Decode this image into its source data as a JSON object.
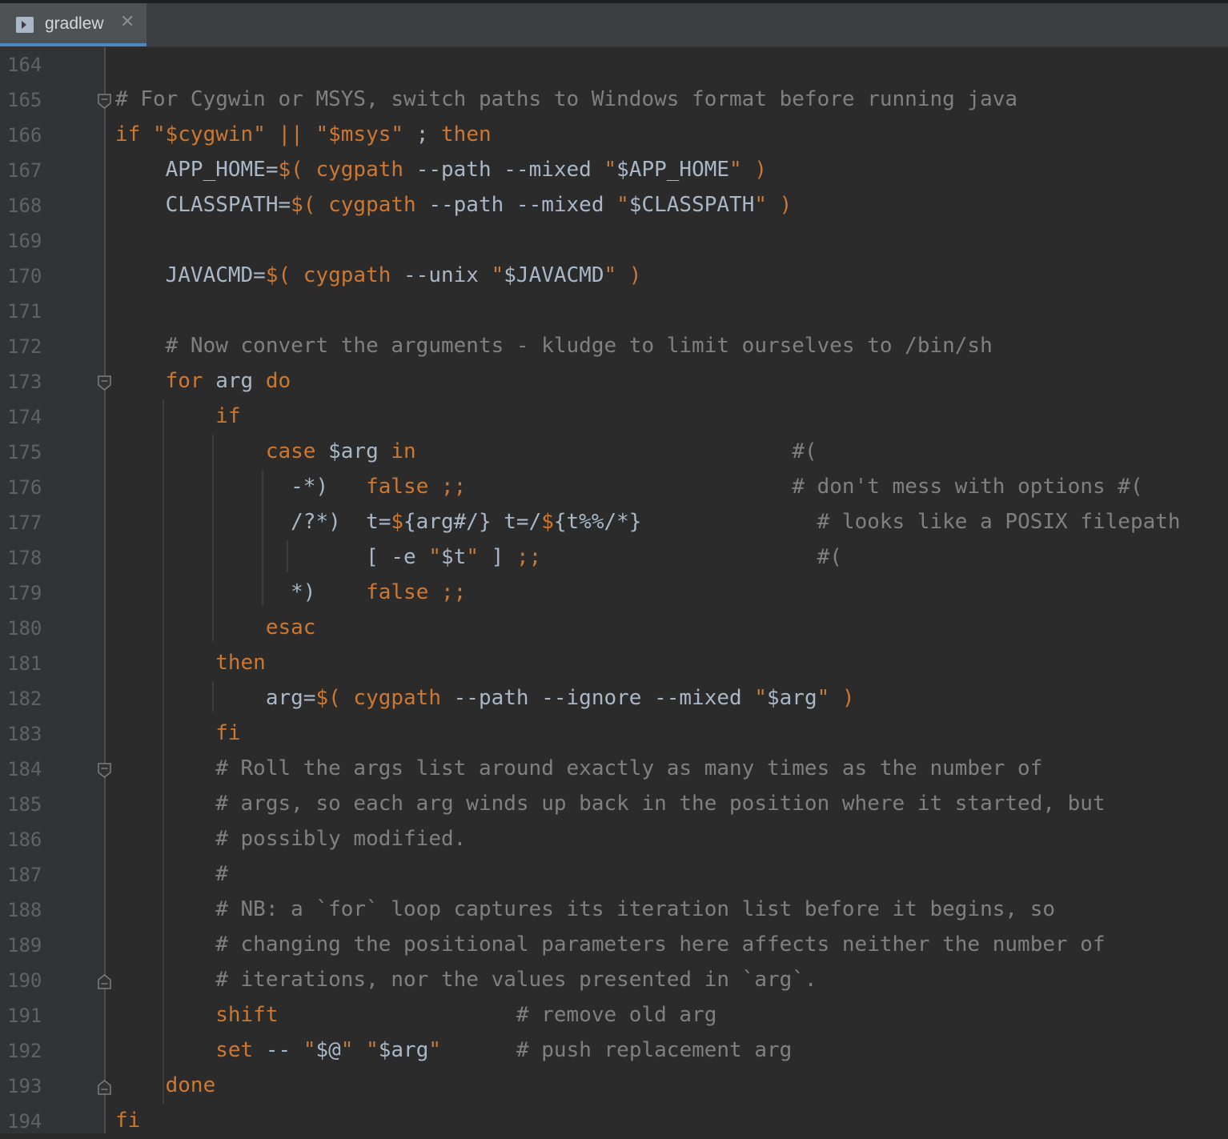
{
  "tab": {
    "title": "gradlew",
    "icon": "terminal-icon",
    "close_icon": "close-icon"
  },
  "colors": {
    "background": "#2b2b2b",
    "gutter": "#313335",
    "keyword": "#cc7832",
    "comment": "#808080",
    "text": "#a9b7c6",
    "line_number": "#606366",
    "tab_active_underline": "#4a88c7"
  },
  "lines": [
    {
      "num": "164",
      "fold": "",
      "parts": []
    },
    {
      "num": "165",
      "fold": "open-top",
      "parts": [
        {
          "t": "cm",
          "v": "# For Cygwin or MSYS, switch paths to Windows format before running java"
        }
      ]
    },
    {
      "num": "166",
      "fold": "",
      "parts": [
        {
          "t": "kw",
          "v": "if "
        },
        {
          "t": "kw",
          "v": "\"$cygwin\" || \"$msys\" "
        },
        {
          "t": "txt",
          "v": "; "
        },
        {
          "t": "kw",
          "v": "then"
        }
      ]
    },
    {
      "num": "167",
      "fold": "",
      "parts": [
        {
          "t": "txt",
          "v": "    APP_HOME="
        },
        {
          "t": "kw",
          "v": "$( cygpath "
        },
        {
          "t": "txt",
          "v": "--path --mixed "
        },
        {
          "t": "kw",
          "v": "\""
        },
        {
          "t": "txt",
          "v": "$APP_HOME"
        },
        {
          "t": "kw",
          "v": "\" )"
        }
      ]
    },
    {
      "num": "168",
      "fold": "",
      "parts": [
        {
          "t": "txt",
          "v": "    CLASSPATH="
        },
        {
          "t": "kw",
          "v": "$( cygpath "
        },
        {
          "t": "txt",
          "v": "--path --mixed "
        },
        {
          "t": "kw",
          "v": "\""
        },
        {
          "t": "txt",
          "v": "$CLASSPATH"
        },
        {
          "t": "kw",
          "v": "\" )"
        }
      ]
    },
    {
      "num": "169",
      "fold": "",
      "parts": []
    },
    {
      "num": "170",
      "fold": "",
      "parts": [
        {
          "t": "txt",
          "v": "    JAVACMD="
        },
        {
          "t": "kw",
          "v": "$( cygpath "
        },
        {
          "t": "txt",
          "v": "--unix "
        },
        {
          "t": "kw",
          "v": "\""
        },
        {
          "t": "txt",
          "v": "$JAVACMD"
        },
        {
          "t": "kw",
          "v": "\" )"
        }
      ]
    },
    {
      "num": "171",
      "fold": "",
      "parts": []
    },
    {
      "num": "172",
      "fold": "",
      "parts": [
        {
          "t": "cm",
          "v": "    # Now convert the arguments - kludge to limit ourselves to /bin/sh"
        }
      ]
    },
    {
      "num": "173",
      "fold": "open-top",
      "parts": [
        {
          "t": "kw",
          "v": "    for "
        },
        {
          "t": "txt",
          "v": "arg "
        },
        {
          "t": "kw",
          "v": "do"
        }
      ]
    },
    {
      "num": "174",
      "fold": "",
      "parts": [
        {
          "t": "kw",
          "v": "        if"
        }
      ]
    },
    {
      "num": "175",
      "fold": "",
      "parts": [
        {
          "t": "kw",
          "v": "            case "
        },
        {
          "t": "txt",
          "v": "$arg "
        },
        {
          "t": "kw",
          "v": "in"
        },
        {
          "t": "txt",
          "v": "                              "
        },
        {
          "t": "cm",
          "v": "#("
        }
      ]
    },
    {
      "num": "176",
      "fold": "",
      "parts": [
        {
          "t": "txt",
          "v": "              -*)   "
        },
        {
          "t": "kw",
          "v": "false ;;"
        },
        {
          "t": "txt",
          "v": "                          "
        },
        {
          "t": "cm",
          "v": "# don't mess with options #("
        }
      ]
    },
    {
      "num": "177",
      "fold": "",
      "parts": [
        {
          "t": "txt",
          "v": "              /?*)  t="
        },
        {
          "t": "kw",
          "v": "$"
        },
        {
          "t": "txt",
          "v": "{arg#/} t=/"
        },
        {
          "t": "kw",
          "v": "$"
        },
        {
          "t": "txt",
          "v": "{t%%/*}"
        },
        {
          "t": "txt",
          "v": "              "
        },
        {
          "t": "cm",
          "v": "# looks like a POSIX filepath"
        }
      ]
    },
    {
      "num": "178",
      "fold": "",
      "parts": [
        {
          "t": "txt",
          "v": "                    [ -e "
        },
        {
          "t": "kw",
          "v": "\""
        },
        {
          "t": "txt",
          "v": "$t"
        },
        {
          "t": "kw",
          "v": "\" "
        },
        {
          "t": "txt",
          "v": "] "
        },
        {
          "t": "kw",
          "v": ";;"
        },
        {
          "t": "txt",
          "v": "                      "
        },
        {
          "t": "cm",
          "v": "#("
        }
      ]
    },
    {
      "num": "179",
      "fold": "",
      "parts": [
        {
          "t": "txt",
          "v": "              *)    "
        },
        {
          "t": "kw",
          "v": "false ;;"
        }
      ]
    },
    {
      "num": "180",
      "fold": "",
      "parts": [
        {
          "t": "kw",
          "v": "            esac"
        }
      ]
    },
    {
      "num": "181",
      "fold": "",
      "parts": [
        {
          "t": "kw",
          "v": "        then"
        }
      ]
    },
    {
      "num": "182",
      "fold": "",
      "parts": [
        {
          "t": "txt",
          "v": "            arg="
        },
        {
          "t": "kw",
          "v": "$( cygpath "
        },
        {
          "t": "txt",
          "v": "--path --ignore --mixed "
        },
        {
          "t": "kw",
          "v": "\""
        },
        {
          "t": "txt",
          "v": "$arg"
        },
        {
          "t": "kw",
          "v": "\" )"
        }
      ]
    },
    {
      "num": "183",
      "fold": "",
      "parts": [
        {
          "t": "kw",
          "v": "        fi"
        }
      ]
    },
    {
      "num": "184",
      "fold": "open-top",
      "parts": [
        {
          "t": "cm",
          "v": "        # Roll the args list around exactly as many times as the number of"
        }
      ]
    },
    {
      "num": "185",
      "fold": "",
      "parts": [
        {
          "t": "cm",
          "v": "        # args, so each arg winds up back in the position where it started, but"
        }
      ]
    },
    {
      "num": "186",
      "fold": "",
      "parts": [
        {
          "t": "cm",
          "v": "        # possibly modified."
        }
      ]
    },
    {
      "num": "187",
      "fold": "",
      "parts": [
        {
          "t": "cm",
          "v": "        #"
        }
      ]
    },
    {
      "num": "188",
      "fold": "",
      "parts": [
        {
          "t": "cm",
          "v": "        # NB: a `for` loop captures its iteration list before it begins, so"
        }
      ]
    },
    {
      "num": "189",
      "fold": "",
      "parts": [
        {
          "t": "cm",
          "v": "        # changing the positional parameters here affects neither the number of"
        }
      ]
    },
    {
      "num": "190",
      "fold": "close",
      "parts": [
        {
          "t": "cm",
          "v": "        # iterations, nor the values presented in `arg`."
        }
      ]
    },
    {
      "num": "191",
      "fold": "",
      "parts": [
        {
          "t": "kw",
          "v": "        shift"
        },
        {
          "t": "txt",
          "v": "                   "
        },
        {
          "t": "cm",
          "v": "# remove old arg"
        }
      ]
    },
    {
      "num": "192",
      "fold": "",
      "parts": [
        {
          "t": "kw",
          "v": "        set "
        },
        {
          "t": "txt",
          "v": "-- "
        },
        {
          "t": "kw",
          "v": "\""
        },
        {
          "t": "txt",
          "v": "$@"
        },
        {
          "t": "kw",
          "v": "\" \""
        },
        {
          "t": "txt",
          "v": "$arg"
        },
        {
          "t": "kw",
          "v": "\""
        },
        {
          "t": "txt",
          "v": "      "
        },
        {
          "t": "cm",
          "v": "# push replacement arg"
        }
      ]
    },
    {
      "num": "193",
      "fold": "close",
      "parts": [
        {
          "t": "kw",
          "v": "    done"
        }
      ]
    },
    {
      "num": "194",
      "fold": "",
      "parts": [
        {
          "t": "kw",
          "v": "fi"
        }
      ]
    }
  ]
}
